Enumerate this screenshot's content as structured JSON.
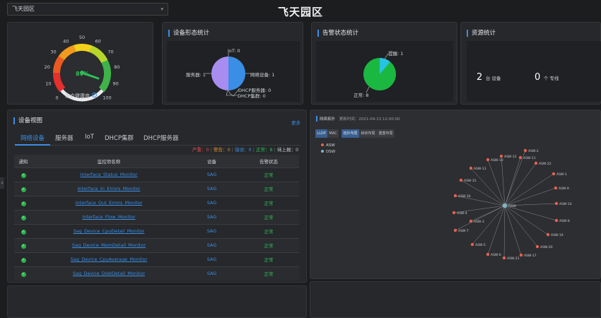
{
  "header": {
    "title": "飞天园区",
    "selector_value": "飞天园区"
  },
  "health": {
    "title": "综合健康度",
    "value_label": "89%",
    "value": 89,
    "ticks": [
      "0",
      "10",
      "20",
      "30",
      "40",
      "50",
      "60",
      "70",
      "80",
      "90",
      "100"
    ]
  },
  "device_form": {
    "title": "设备形态统计",
    "labels": {
      "iot": "IoT: 0",
      "server": "服务器: 1",
      "network": "网络设备: 1",
      "dhcp_server": "DHCP服务器: 0",
      "dhcp_cluster": "DHCP集群: 0"
    },
    "slices": [
      {
        "name": "服务器",
        "value": 1,
        "color": "#a98cf0"
      },
      {
        "name": "网络设备",
        "value": 1,
        "color": "#3a8ee6"
      }
    ]
  },
  "alarm_stats": {
    "title": "告警状态统计",
    "labels": {
      "warning": "提醒: 1",
      "normal": "正常: 8"
    },
    "slices": [
      {
        "name": "正常",
        "value": 8,
        "color": "#1bb841"
      },
      {
        "name": "提醒",
        "value": 1,
        "color": "#27c3e3"
      }
    ]
  },
  "resources": {
    "title": "资源统计",
    "devices_num": "2",
    "devices_unit": "台 设备",
    "lines_num": "0",
    "lines_unit": "个 专线"
  },
  "device_view": {
    "title": "设备视图",
    "more": "更多",
    "tabs": [
      "网络设备",
      "服务器",
      "IoT",
      "DHCP集群",
      "DHCP服务器"
    ],
    "status_bar": {
      "severe": "严重：0",
      "major": "警告：0",
      "minor": "错误：0",
      "normal": "正常：8",
      "pending": "待上报：0"
    },
    "columns": [
      "通知",
      "监控项名称",
      "设备",
      "告警状态"
    ],
    "rows": [
      {
        "name": "Interface_Status_Monitor",
        "device": "SAG",
        "status": "正常"
      },
      {
        "name": "Interface_In_Errors_Monitor",
        "device": "SAG",
        "status": "正常"
      },
      {
        "name": "Interface_Out_Errors_Monitor",
        "device": "SAG",
        "status": "正常"
      },
      {
        "name": "Interface_Flow_Monitor",
        "device": "SAG",
        "status": "正常"
      },
      {
        "name": "Sag_Device_CpuDetail_Monitor",
        "device": "SAG",
        "status": "正常"
      },
      {
        "name": "Sag_Device_MemDetail_Monitor",
        "device": "SAG",
        "status": "正常"
      },
      {
        "name": "Sag_Device_CpuAverage_Monitor",
        "device": "SAG",
        "status": "正常"
      },
      {
        "name": "Sag_Device_DiskDetail_Monitor",
        "device": "SAG",
        "status": "正常"
      }
    ]
  },
  "topology": {
    "title": "网络拓扑",
    "update_time": "更新时间：2021-04-13 12:00:00",
    "buttons": [
      "LLDP",
      "MAC",
      "拓扑布局",
      "树状布局",
      "重置布局"
    ],
    "legend": [
      "ASW",
      "DSW"
    ],
    "center_label": "DSW",
    "nodes": [
      "ASW-12",
      "ASW-11",
      "ASW-10",
      "ASW-22",
      "ASW-13",
      "ASW-1",
      "ASW-15",
      "ASW-9",
      "ASW-16",
      "ASW-14",
      "ASW-4",
      "ASW-8",
      "ASW-7",
      "ASW-3",
      "ASW-19",
      "ASW-5",
      "ASW-20",
      "ASW-6",
      "ASW-17",
      "ASW-21",
      "ASW-2"
    ]
  },
  "colors": {
    "accent": "#3a8ee6",
    "normal": "#2fbf57",
    "severe": "#e5484d",
    "major": "#e08c2a",
    "minor": "#3a8ee6"
  }
}
